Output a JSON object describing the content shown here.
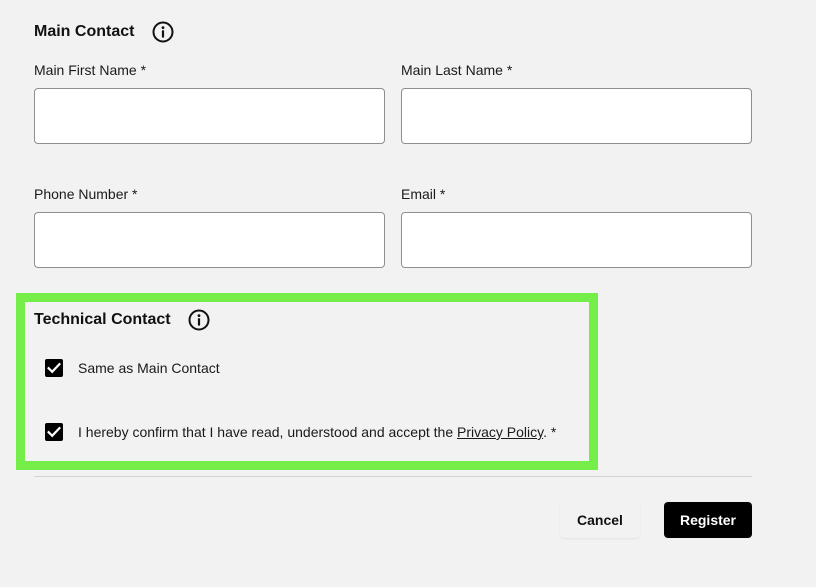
{
  "main_contact": {
    "title": "Main Contact",
    "icon": "info-icon",
    "first_name": {
      "label": "Main First Name *",
      "value": "",
      "placeholder": ""
    },
    "last_name": {
      "label": "Main Last Name *",
      "value": "",
      "placeholder": ""
    },
    "phone": {
      "label": "Phone Number *",
      "value": "",
      "placeholder": ""
    },
    "email": {
      "label": "Email *",
      "value": "",
      "placeholder": ""
    }
  },
  "technical_contact": {
    "title": "Technical Contact",
    "icon": "info-icon",
    "same_as_main": {
      "label": "Same as Main Contact",
      "checked": true
    },
    "privacy": {
      "label_before": "I hereby confirm that I have read, understood and accept the ",
      "link_text": "Privacy Policy",
      "label_after": ". *",
      "checked": true
    }
  },
  "actions": {
    "cancel_label": "Cancel",
    "register_label": "Register"
  },
  "colors": {
    "highlight": "#76ee4a",
    "background": "#f2f2f2",
    "primary_button": "#000000"
  }
}
